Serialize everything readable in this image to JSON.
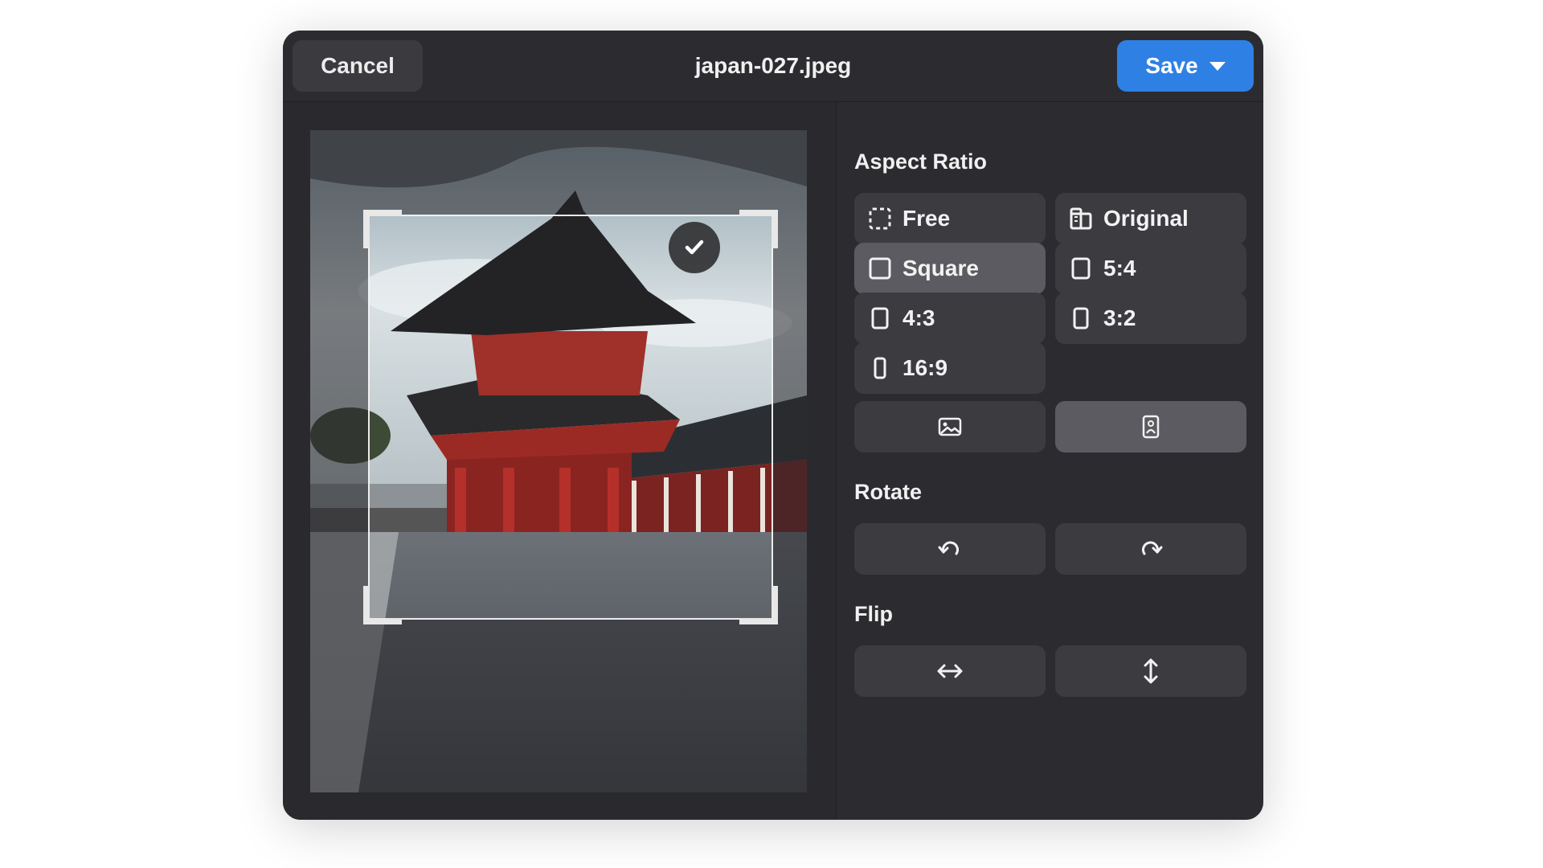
{
  "header": {
    "cancel_label": "Cancel",
    "filename": "japan-027.jpeg",
    "save_label": "Save"
  },
  "panel": {
    "aspect_ratio_title": "Aspect Ratio",
    "aspect_options": [
      {
        "label": "Free",
        "icon": "dashed-square-icon",
        "selected": false
      },
      {
        "label": "Original",
        "icon": "original-ratio-icon",
        "selected": false
      },
      {
        "label": "Square",
        "icon": "square-icon",
        "selected": true
      },
      {
        "label": "5:4",
        "icon": "portrait-rect-icon",
        "selected": false
      },
      {
        "label": "4:3",
        "icon": "portrait-rect-icon",
        "selected": false
      },
      {
        "label": "3:2",
        "icon": "portrait-rect-icon",
        "selected": false
      },
      {
        "label": "16:9",
        "icon": "portrait-rect-icon",
        "selected": false
      }
    ],
    "orientation": {
      "landscape_icon": "landscape-image-icon",
      "portrait_icon": "portrait-image-icon",
      "selected": "portrait"
    },
    "rotate_title": "Rotate",
    "rotate_icons": [
      "rotate-left-icon",
      "rotate-right-icon"
    ],
    "flip_title": "Flip",
    "flip_icons": [
      "flip-horizontal-icon",
      "flip-vertical-icon"
    ]
  },
  "colors": {
    "accent": "#2f80e4",
    "dialog_bg": "#2a2a2e",
    "option_bg": "#3b3b40",
    "option_active_bg": "#5b5b61"
  }
}
